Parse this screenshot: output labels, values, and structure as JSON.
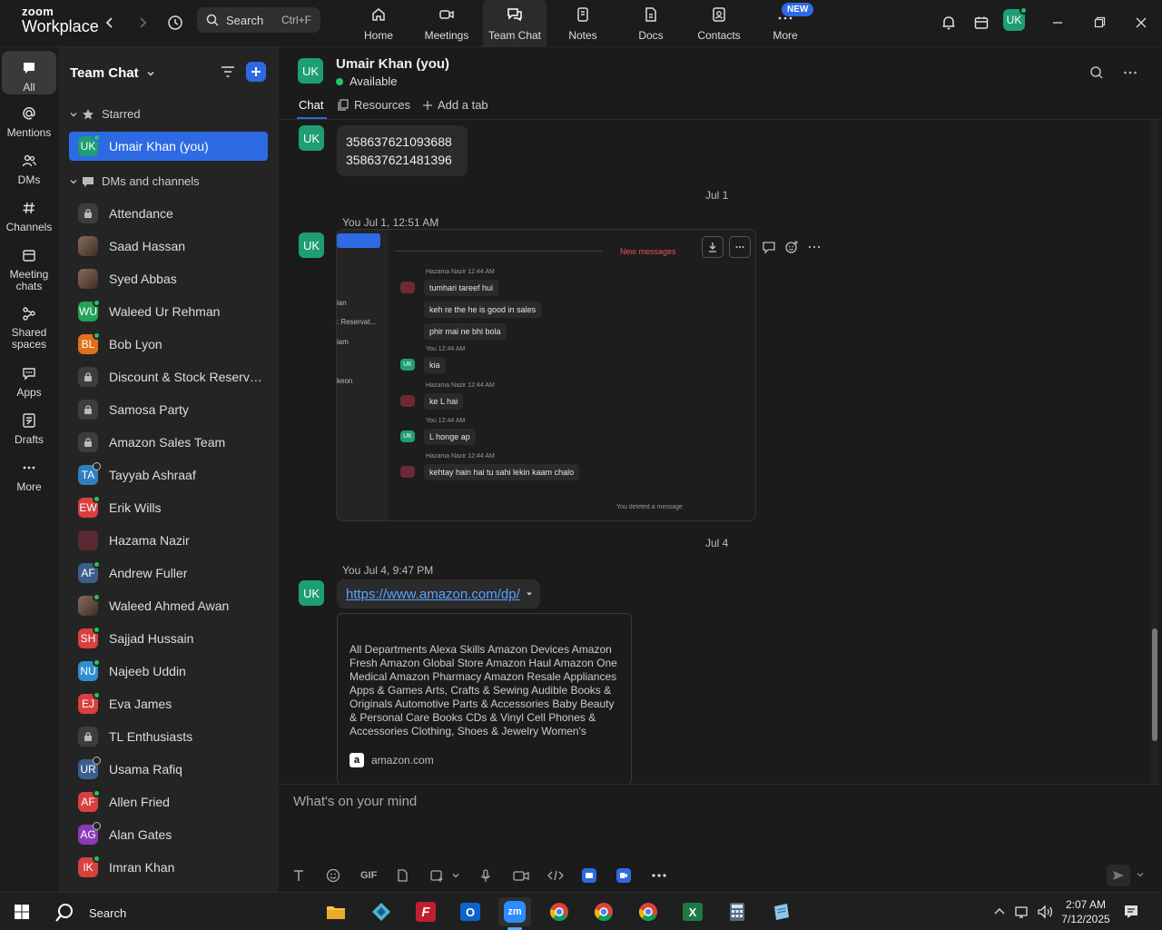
{
  "app": {
    "brand_top": "zoom",
    "brand_bottom": "Workplace"
  },
  "topbar": {
    "search_label": "Search",
    "search_shortcut": "Ctrl+F",
    "nav": [
      {
        "label": "Home",
        "icon": "home-icon"
      },
      {
        "label": "Meetings",
        "icon": "video-icon"
      },
      {
        "label": "Team Chat",
        "icon": "chat-icon"
      },
      {
        "label": "Notes",
        "icon": "notes-icon"
      },
      {
        "label": "Docs",
        "icon": "docs-icon"
      },
      {
        "label": "Contacts",
        "icon": "contacts-icon"
      },
      {
        "label": "More",
        "icon": "more-icon"
      }
    ],
    "new_badge": "NEW",
    "user_initials": "UK",
    "accent": "#2d6ae3"
  },
  "rail": [
    {
      "label": "All",
      "icon": "chat-bubble-icon"
    },
    {
      "label": "Mentions",
      "icon": "at-icon"
    },
    {
      "label": "DMs",
      "icon": "people-icon"
    },
    {
      "label": "Channels",
      "icon": "hash-icon"
    },
    {
      "label": "Meeting chats",
      "icon": "calendar-icon"
    },
    {
      "label": "Shared spaces",
      "icon": "shared-icon"
    },
    {
      "label": "Apps",
      "icon": "apps-icon"
    },
    {
      "label": "Drafts",
      "icon": "drafts-icon"
    },
    {
      "label": "More",
      "icon": "ellipsis-icon"
    }
  ],
  "sidebar": {
    "title": "Team Chat",
    "starred_label": "Starred",
    "starred": [
      {
        "initials": "UK",
        "name": "Umair Khan (you)",
        "color": "#1e9e74"
      }
    ],
    "dms_label": "DMs and channels",
    "items": [
      {
        "initials": "",
        "name": "Attendance",
        "kind": "lock"
      },
      {
        "initials": "",
        "name": "Saad Hassan",
        "kind": "photo"
      },
      {
        "initials": "",
        "name": "Syed Abbas",
        "kind": "photo"
      },
      {
        "initials": "WU",
        "name": "Waleed Ur Rehman",
        "color": "#22a35a",
        "status": "g"
      },
      {
        "initials": "BL",
        "name": "Bob Lyon",
        "color": "#e0711b",
        "status": "g"
      },
      {
        "initials": "",
        "name": "Discount & Stock Reservati...",
        "kind": "lock"
      },
      {
        "initials": "",
        "name": "Samosa Party",
        "kind": "lock"
      },
      {
        "initials": "",
        "name": "Amazon Sales Team",
        "kind": "lock"
      },
      {
        "initials": "TA",
        "name": "Tayyab Ashraaf",
        "color": "#2f7fbf",
        "status": "o"
      },
      {
        "initials": "EW",
        "name": "Erik Wills",
        "color": "#d94040",
        "status": "g"
      },
      {
        "initials": "",
        "name": "Hazama Nazir",
        "kind": "photo2"
      },
      {
        "initials": "AF",
        "name": "Andrew Fuller",
        "color": "#3b5f8a",
        "status": "g"
      },
      {
        "initials": "",
        "name": "Waleed Ahmed Awan",
        "kind": "photo",
        "status": "g"
      },
      {
        "initials": "SH",
        "name": "Sajjad Hussain",
        "color": "#d94040",
        "status": "g"
      },
      {
        "initials": "NU",
        "name": "Najeeb Uddin",
        "color": "#2f8fd0",
        "status": "g"
      },
      {
        "initials": "EJ",
        "name": "Eva James",
        "color": "#d94040",
        "status": "g"
      },
      {
        "initials": "",
        "name": "TL Enthusiasts",
        "kind": "lock"
      },
      {
        "initials": "UR",
        "name": "Usama Rafiq",
        "color": "#3b5f8a",
        "status": "o"
      },
      {
        "initials": "AF",
        "name": "Allen Fried",
        "color": "#d94040",
        "status": "g"
      },
      {
        "initials": "AG",
        "name": "Alan Gates",
        "color": "#8a3bb8",
        "status": "o"
      },
      {
        "initials": "IK",
        "name": "Imran Khan",
        "color": "#d94040",
        "status": "g"
      }
    ]
  },
  "channel": {
    "initials": "UK",
    "name": "Umair Khan (you)",
    "status": "Available",
    "tabs": [
      {
        "label": "Chat"
      },
      {
        "label": "Resources"
      },
      {
        "label": "Add a tab"
      }
    ]
  },
  "messages": {
    "first_bubble": [
      "358637621093688",
      "358637621481396"
    ],
    "date1": "Jul 1",
    "meta1": "You Jul 1, 12:51 AM",
    "date2": "Jul 4",
    "meta2": "You Jul 4, 9:47 PM",
    "link": "https://www.amazon.com/dp/",
    "preview_text": "All Departments Alexa Skills Amazon Devices Amazon Fresh Amazon Global Store Amazon Haul Amazon One Medical Amazon Pharmacy Amazon Resale Appliances Apps & Games Arts, Crafts & Sewing Audible Books & Originals Automotive Parts & Accessories Baby Beauty & Personal Care Books CDs & Vinyl Cell Phones & Accessories Clothing, Shoes & Jewelry Women's",
    "preview_domain": "amazon.com",
    "screenshot": {
      "new_messages": "New messages",
      "left_labels": [
        "ian",
        ": Reservat...",
        "iam",
        "keon"
      ],
      "rows": [
        {
          "type": "meta",
          "text": "Hazama Nazir 12:44 AM"
        },
        {
          "type": "msg",
          "text": "tumhari tareef hui"
        },
        {
          "type": "msg",
          "text": "keh re the he is good in sales"
        },
        {
          "type": "msg",
          "text": "phir mai ne bhi bola"
        },
        {
          "type": "meta",
          "text": "You 12:44 AM"
        },
        {
          "type": "msg",
          "text": "kia"
        },
        {
          "type": "meta",
          "text": "Hazama Nazir 12:44 AM"
        },
        {
          "type": "msg",
          "text": "ke L hai"
        },
        {
          "type": "meta",
          "text": "You 12:44 AM"
        },
        {
          "type": "msg",
          "text": "L honge ap"
        },
        {
          "type": "meta",
          "text": "Hazama Nazir 12:44 AM"
        },
        {
          "type": "msg",
          "text": "kehtay hain hai tu sahi lekin kaam chalo"
        }
      ],
      "avatar_initials": "UK",
      "deleted": "You deleted a message"
    }
  },
  "composer": {
    "placeholder": "What's on your mind",
    "gif_label": "GIF"
  },
  "taskbar": {
    "search_label": "Search",
    "time": "2:07 AM",
    "date": "7/12/2025"
  }
}
